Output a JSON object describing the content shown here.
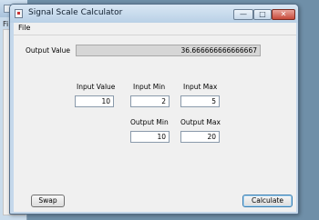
{
  "back_window": {
    "title": "(",
    "menu_label": "File"
  },
  "window": {
    "title": "Signal Scale Calculator",
    "controls": {
      "minimize": "—",
      "maximize": "□",
      "close": "✕"
    }
  },
  "menu": {
    "file": "File"
  },
  "output": {
    "label": "Output Value",
    "value": "36.666666666666667"
  },
  "inputs": {
    "input_value": {
      "label": "Input Value",
      "value": "10"
    },
    "input_min": {
      "label": "Input Min",
      "value": "2"
    },
    "input_max": {
      "label": "Input Max",
      "value": "5"
    },
    "output_min": {
      "label": "Output Min",
      "value": "10"
    },
    "output_max": {
      "label": "Output Max",
      "value": "20"
    }
  },
  "buttons": {
    "swap": "Swap",
    "calculate": "Calculate"
  },
  "icons": {
    "app": "app-window-icon",
    "minimize": "minimize-icon",
    "maximize": "maximize-icon",
    "close": "close-icon"
  }
}
